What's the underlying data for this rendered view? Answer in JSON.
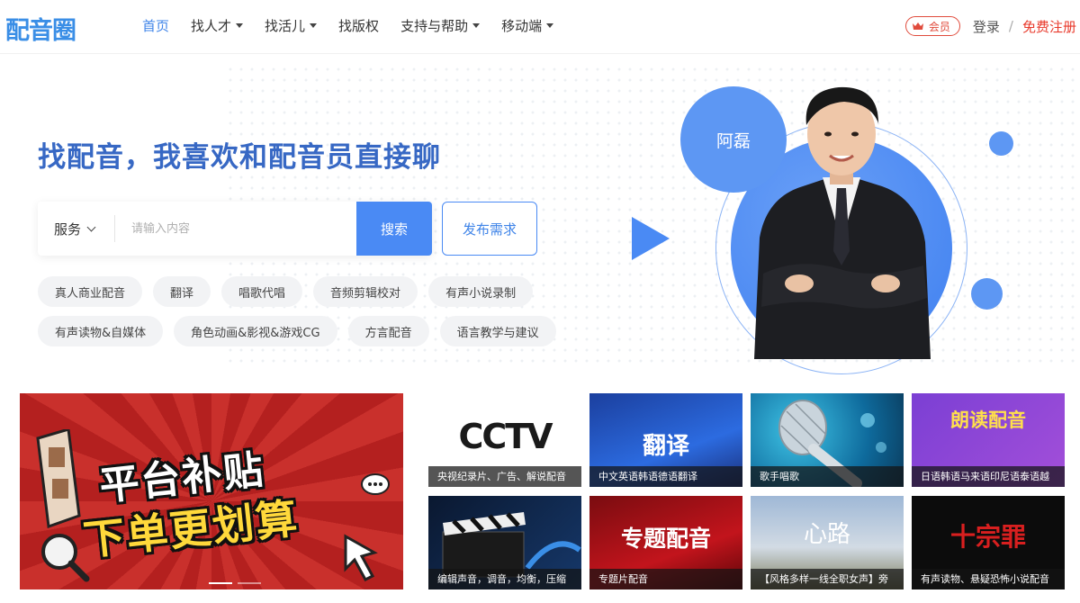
{
  "header": {
    "logo": "配音圈",
    "nav": [
      {
        "label": "首页",
        "active": true,
        "dropdown": false
      },
      {
        "label": "找人才",
        "active": false,
        "dropdown": true
      },
      {
        "label": "找活儿",
        "active": false,
        "dropdown": true
      },
      {
        "label": "找版权",
        "active": false,
        "dropdown": false
      },
      {
        "label": "支持与帮助",
        "active": false,
        "dropdown": true
      },
      {
        "label": "移动端",
        "active": false,
        "dropdown": true
      }
    ],
    "vip": "会员",
    "login": "登录",
    "separator": "/",
    "register": "免费注册"
  },
  "hero": {
    "title": "找配音，我喜欢和配音员直接聊",
    "search": {
      "select_value": "服务",
      "placeholder": "请输入内容",
      "button": "搜索"
    },
    "publish": "发布需求",
    "tags": [
      "真人商业配音",
      "翻译",
      "唱歌代唱",
      "音频剪辑校对",
      "有声小说录制",
      "有声读物&自媒体",
      "角色动画&影视&游戏CG",
      "方言配音",
      "语言教学与建议"
    ],
    "person_name": "阿磊"
  },
  "banner": {
    "line1": "平台补贴",
    "line2": "下单更划算"
  },
  "cards": [
    {
      "caption": "央视纪录片、广告、解说配音",
      "art_text": "CCTV"
    },
    {
      "caption": "中文英语韩语德语翻译",
      "art_text": "翻译"
    },
    {
      "caption": "歌手唱歌",
      "art_text": ""
    },
    {
      "caption": "日语韩语马来语印尼语泰语越",
      "art_text": "朗读配音"
    },
    {
      "caption": "编辑声音，调音，均衡，压缩",
      "art_text": ""
    },
    {
      "caption": "专题片配音",
      "art_text": "专题配音"
    },
    {
      "caption": "【风格多样一线全职女声】旁",
      "art_text": "心路"
    },
    {
      "caption": "有声读物、悬疑恐怖小说配音",
      "art_text": "十宗罪"
    }
  ],
  "colors": {
    "accent": "#4a8af4",
    "title": "#3768c4",
    "register": "#e8392b"
  }
}
